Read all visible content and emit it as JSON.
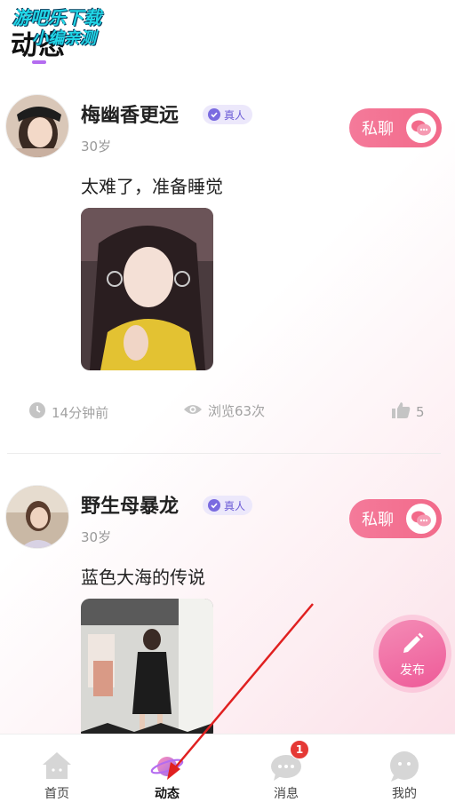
{
  "header": {
    "title": "动态",
    "watermark_line1": "游吧乐下载",
    "watermark_line2": "小编亲测"
  },
  "posts": [
    {
      "username": "梅幽香更远",
      "verified_label": "真人",
      "age": "30岁",
      "text": "太难了，准备睡觉",
      "chat_label": "私聊",
      "time": "14分钟前",
      "views": "浏览63次",
      "likes": "5"
    },
    {
      "username": "野生母暴龙",
      "verified_label": "真人",
      "age": "30岁",
      "text": "蓝色大海的传说",
      "chat_label": "私聊"
    }
  ],
  "fab": {
    "label": "发布"
  },
  "bottom_nav": {
    "items": [
      {
        "label": "首页",
        "icon": "home-icon",
        "active": false
      },
      {
        "label": "动态",
        "icon": "planet-icon",
        "active": true
      },
      {
        "label": "消息",
        "icon": "chat-bubbles-icon",
        "active": false,
        "badge": "1"
      },
      {
        "label": "我的",
        "icon": "profile-bubble-icon",
        "active": false
      }
    ]
  },
  "colors": {
    "accent_pink": "#f26a8a",
    "accent_purple": "#b46cf0",
    "badge_red": "#e53935",
    "verified_purple": "#7a6be0"
  }
}
